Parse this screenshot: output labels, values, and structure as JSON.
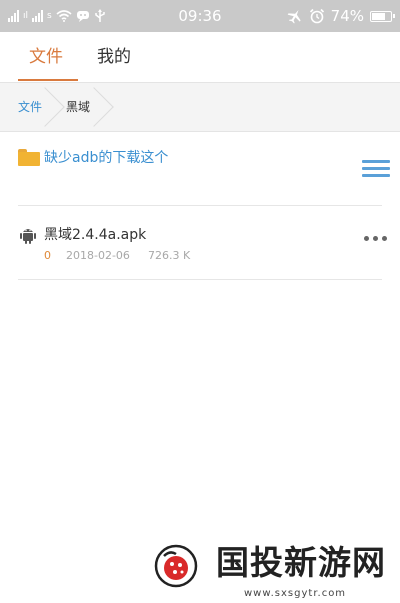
{
  "status_bar": {
    "carrier_1": "ıl",
    "carrier_2": "ıl",
    "network_type": "s",
    "time": "09:36",
    "battery_percent": "74%",
    "battery_level": 0.74,
    "icons": [
      "signal-icon",
      "signal-icon",
      "wifi-icon",
      "chat-icon",
      "usb-icon",
      "airplane-icon",
      "alarm-icon",
      "battery-icon"
    ]
  },
  "tabs": [
    {
      "label": "文件",
      "active": true
    },
    {
      "label": "我的",
      "active": false
    }
  ],
  "breadcrumb": {
    "root": "文件",
    "current": "黑域"
  },
  "folder": {
    "name": "缺少adb的下载这个",
    "icon": "folder-icon"
  },
  "files": [
    {
      "name": "黑域2.4.4a.apk",
      "count": "0",
      "date": "2018-02-06",
      "size": "726.3 K",
      "icon": "android-icon"
    }
  ],
  "watermark": {
    "title": "国投新游网",
    "url": "www.sxsgytr.com"
  },
  "colors": {
    "accent_orange": "#d97a3e",
    "link_blue": "#3a8fd0",
    "status_bar_bg": "#c9c9c9",
    "folder_yellow": "#f1b333"
  }
}
